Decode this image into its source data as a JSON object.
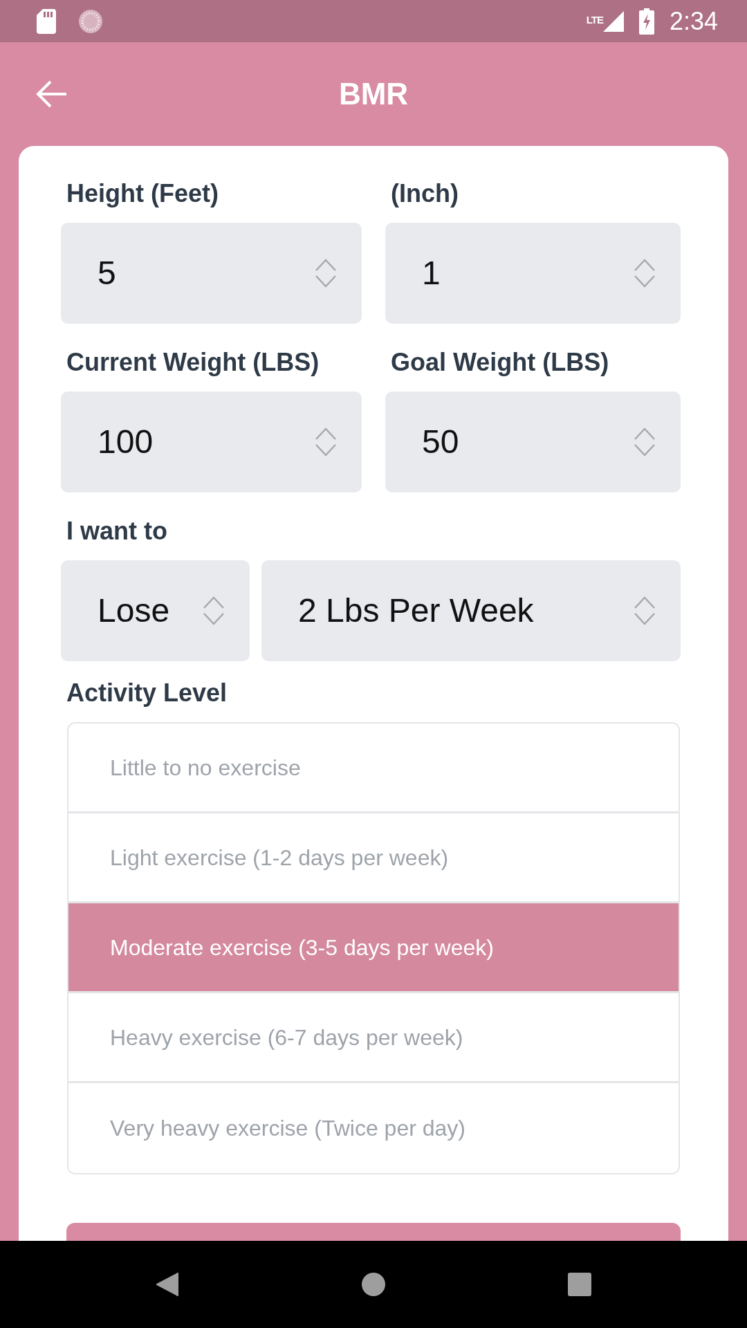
{
  "status_bar": {
    "network": "LTE",
    "time": "2:34"
  },
  "header": {
    "title": "BMR"
  },
  "form": {
    "rows": [
      {
        "fields": [
          {
            "label": "Height (Feet)",
            "value": "5"
          },
          {
            "label": "(Inch)",
            "value": "1"
          }
        ]
      },
      {
        "fields": [
          {
            "label": "Current Weight (LBS)",
            "value": "100"
          },
          {
            "label": "Goal Weight (LBS)",
            "value": "50"
          }
        ]
      }
    ],
    "goal": {
      "label": "I want to",
      "selects": [
        {
          "value": "Lose"
        },
        {
          "value": "2 Lbs Per Week"
        }
      ]
    },
    "activity": {
      "label": "Activity Level",
      "options": [
        {
          "label": "Little to no exercise",
          "selected": false
        },
        {
          "label": "Light exercise (1-2 days per week)",
          "selected": false
        },
        {
          "label": "Moderate exercise (3-5 days per week)",
          "selected": true
        },
        {
          "label": "Heavy exercise (6-7 days per week)",
          "selected": false
        },
        {
          "label": "Very heavy exercise (Twice per day)",
          "selected": false
        }
      ]
    }
  }
}
